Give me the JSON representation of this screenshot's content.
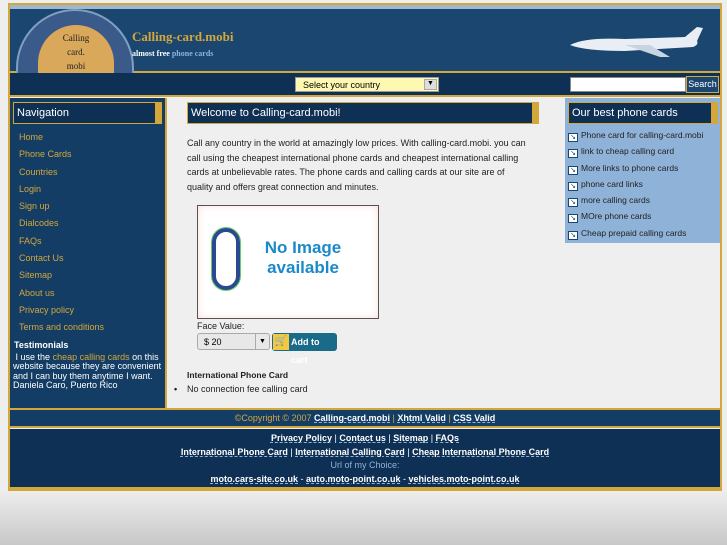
{
  "header": {
    "logo_lines": [
      "Calling",
      "card.",
      "mobi"
    ],
    "title": "Calling-card.mobi",
    "tagline_a": "almost free",
    "tagline_b": "phone cards"
  },
  "navbar": {
    "country_select": "Select your country",
    "search_placeholder": "",
    "search_button": "Search"
  },
  "navigation": {
    "title": "Navigation",
    "items": [
      "Home",
      "Phone Cards",
      "Countries",
      "Login",
      "Sign up",
      "Dialcodes",
      "FAQs",
      "Contact Us",
      "Sitemap",
      "About us",
      "Privacy policy",
      "Terms and conditions"
    ]
  },
  "testimonials": {
    "title": "Testimonials",
    "pre": "I use the",
    "link": "cheap calling cards",
    "post": "on this website because they are convenient and I can buy them anytime I want.",
    "author": "Daniela Caro, Puerto Rico"
  },
  "main": {
    "title": "Welcome to Calling-card.mobi!",
    "intro": "Call any country in the world at amazingly low prices. With calling-card.mobi. you can call using the cheapest international phone cards and cheapest international calling cards at unbelievable rates. The phone cards and calling cards at our site are of quality and offers great connection and minutes.",
    "image_text_1": "No Image",
    "image_text_2": "available",
    "face_value_label": "Face Value:",
    "face_value": "$ 20",
    "add_to_cart": "Add to cart",
    "product_title": "International Phone Card",
    "features": [
      "No connection fee calling card"
    ]
  },
  "best": {
    "title": "Our best phone cards",
    "items": [
      "Phone card for calling-card.mobi",
      "link to cheap calling card",
      "More links to phone cards",
      "phone card links",
      "more calling cards",
      "MOre phone cards",
      "Cheap prepaid calling cards"
    ]
  },
  "footer": {
    "copyright": "©Copyright © 2007",
    "site_link": "Calling-card.mobi",
    "xhtml": "Xhtml Valid",
    "css": "CSS Valid",
    "links1": [
      "Privacy Policy",
      "Contact us",
      "Sitemap",
      "FAQs"
    ],
    "links2": [
      "International Phone Card",
      "International Calling Card",
      "Cheap International Phone Card"
    ],
    "url_label": "Url of my Choice:",
    "links3": [
      "moto.cars-site.co.uk",
      "auto.moto-point.co.uk",
      "vehicles.moto-point.co.uk"
    ]
  },
  "colors": {
    "gold": "#d4a73a",
    "navy": "#143d65",
    "light_blue": "#8fb3d8"
  }
}
